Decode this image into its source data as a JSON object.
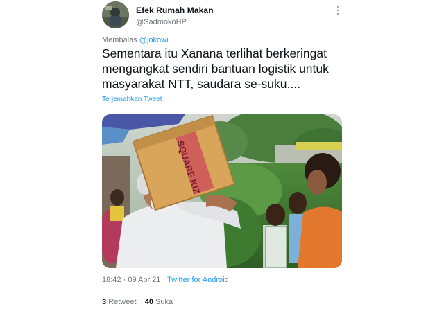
{
  "tweet": {
    "display_name": "Efek Rumah Makan",
    "username": "@SadmokoHP",
    "replying_label": "Membalas",
    "replying_to": "@jokowi",
    "text": "Sementara itu Xanana terlihat berkeringat mengangkat sendiri bantuan logistik untuk masyarakat NTT, saudara se-suku....",
    "translate_label": "Terjemahkan Tweet",
    "time": "18:42",
    "date": "09 Apr 21",
    "source": "Twitter for Android",
    "retweet_count": "3",
    "retweet_label": "Retweet",
    "like_count": "40",
    "like_label": "Suka",
    "box_print": "SQUARE KIZ"
  },
  "icons": {
    "more": "more-options-icon",
    "avatar": "profile-avatar"
  },
  "colors": {
    "link": "#1d9bf0",
    "muted": "#6e767d",
    "text": "#0f1419"
  }
}
